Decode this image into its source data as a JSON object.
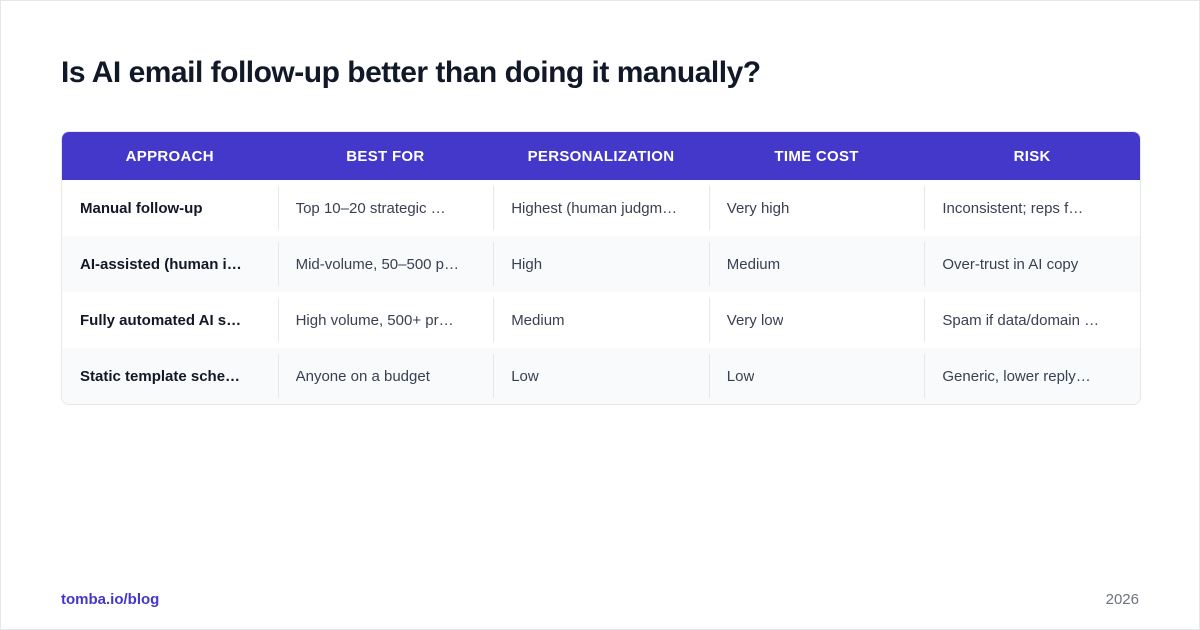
{
  "title": "Is AI email follow-up better than doing it manually?",
  "colors": {
    "header_bg": "#4338ca",
    "brand": "#4338ca"
  },
  "table": {
    "headers": [
      "APPROACH",
      "BEST FOR",
      "PERSONALIZATION",
      "TIME COST",
      "RISK"
    ],
    "rows": [
      [
        "Manual follow-up",
        "Top 10–20 strategic …",
        "Highest (human judgm…",
        "Very high",
        "Inconsistent; reps f…"
      ],
      [
        "AI-assisted (human i…",
        "Mid-volume, 50–500 p…",
        "High",
        "Medium",
        "Over-trust in AI copy"
      ],
      [
        "Fully automated AI s…",
        "High volume, 500+ pr…",
        "Medium",
        "Very low",
        "Spam if data/domain …"
      ],
      [
        "Static template sche…",
        "Anyone on a budget",
        "Low",
        "Low",
        "Generic, lower reply…"
      ]
    ]
  },
  "footer": {
    "source": "tomba.io/blog",
    "year": "2026"
  }
}
